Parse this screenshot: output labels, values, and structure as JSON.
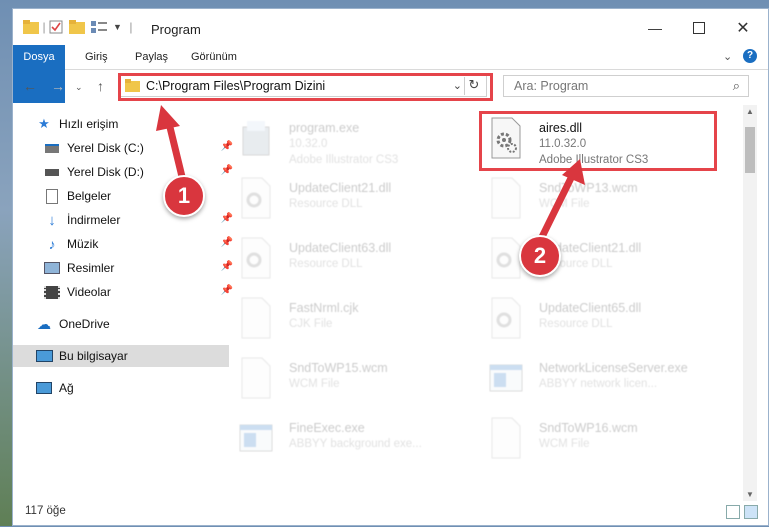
{
  "window": {
    "title": "Program"
  },
  "ribbon": {
    "tabs": [
      "Dosya",
      "Giriş",
      "Paylaş",
      "Görünüm"
    ]
  },
  "address": {
    "path": "C:\\Program Files\\Program Dizini"
  },
  "search": {
    "placeholder": "Ara: Program"
  },
  "sidebar": {
    "items": [
      {
        "label": "Hızlı erişim"
      },
      {
        "label": "Yerel Disk (C:)"
      },
      {
        "label": "Yerel Disk (D:)"
      },
      {
        "label": "Belgeler"
      },
      {
        "label": "İndirmeler"
      },
      {
        "label": "Müzik"
      },
      {
        "label": "Resimler"
      },
      {
        "label": "Videolar"
      },
      {
        "label": "OneDrive"
      },
      {
        "label": "Bu bilgisayar"
      },
      {
        "label": "Ağ"
      }
    ]
  },
  "files": [
    {
      "name": "program.exe",
      "line2": "10.32.0",
      "line3": "Adobe Illustrator CS3"
    },
    {
      "name": "aires.dll",
      "line2": "11.0.32.0",
      "line3": "Adobe Illustrator CS3"
    },
    {
      "name": "UpdateClient21.dll",
      "line2": "Resource DLL",
      "line3": ""
    },
    {
      "name": "SndToWP13.wcm",
      "line2": "WCM File",
      "line3": ""
    },
    {
      "name": "UpdateClient63.dll",
      "line2": "Resource DLL",
      "line3": ""
    },
    {
      "name": "UpdateClient21.dll",
      "line2": "Resource DLL",
      "line3": ""
    },
    {
      "name": "FastNrml.cjk",
      "line2": "CJK File",
      "line3": ""
    },
    {
      "name": "UpdateClient65.dll",
      "line2": "Resource DLL",
      "line3": ""
    },
    {
      "name": "SndToWP15.wcm",
      "line2": "WCM File",
      "line3": ""
    },
    {
      "name": "NetworkLicenseServer.exe",
      "line2": "ABBYY network licen...",
      "line3": ""
    },
    {
      "name": "FineExec.exe",
      "line2": "ABBYY background exe...",
      "line3": ""
    },
    {
      "name": "SndToWP16.wcm",
      "line2": "WCM File",
      "line3": ""
    }
  ],
  "status": {
    "count": "117 öğe"
  },
  "annotations": {
    "step1": "1",
    "step2": "2"
  },
  "colors": {
    "accent": "#1a6ec1",
    "highlight": "#e5444a",
    "badge": "#d9363e"
  }
}
